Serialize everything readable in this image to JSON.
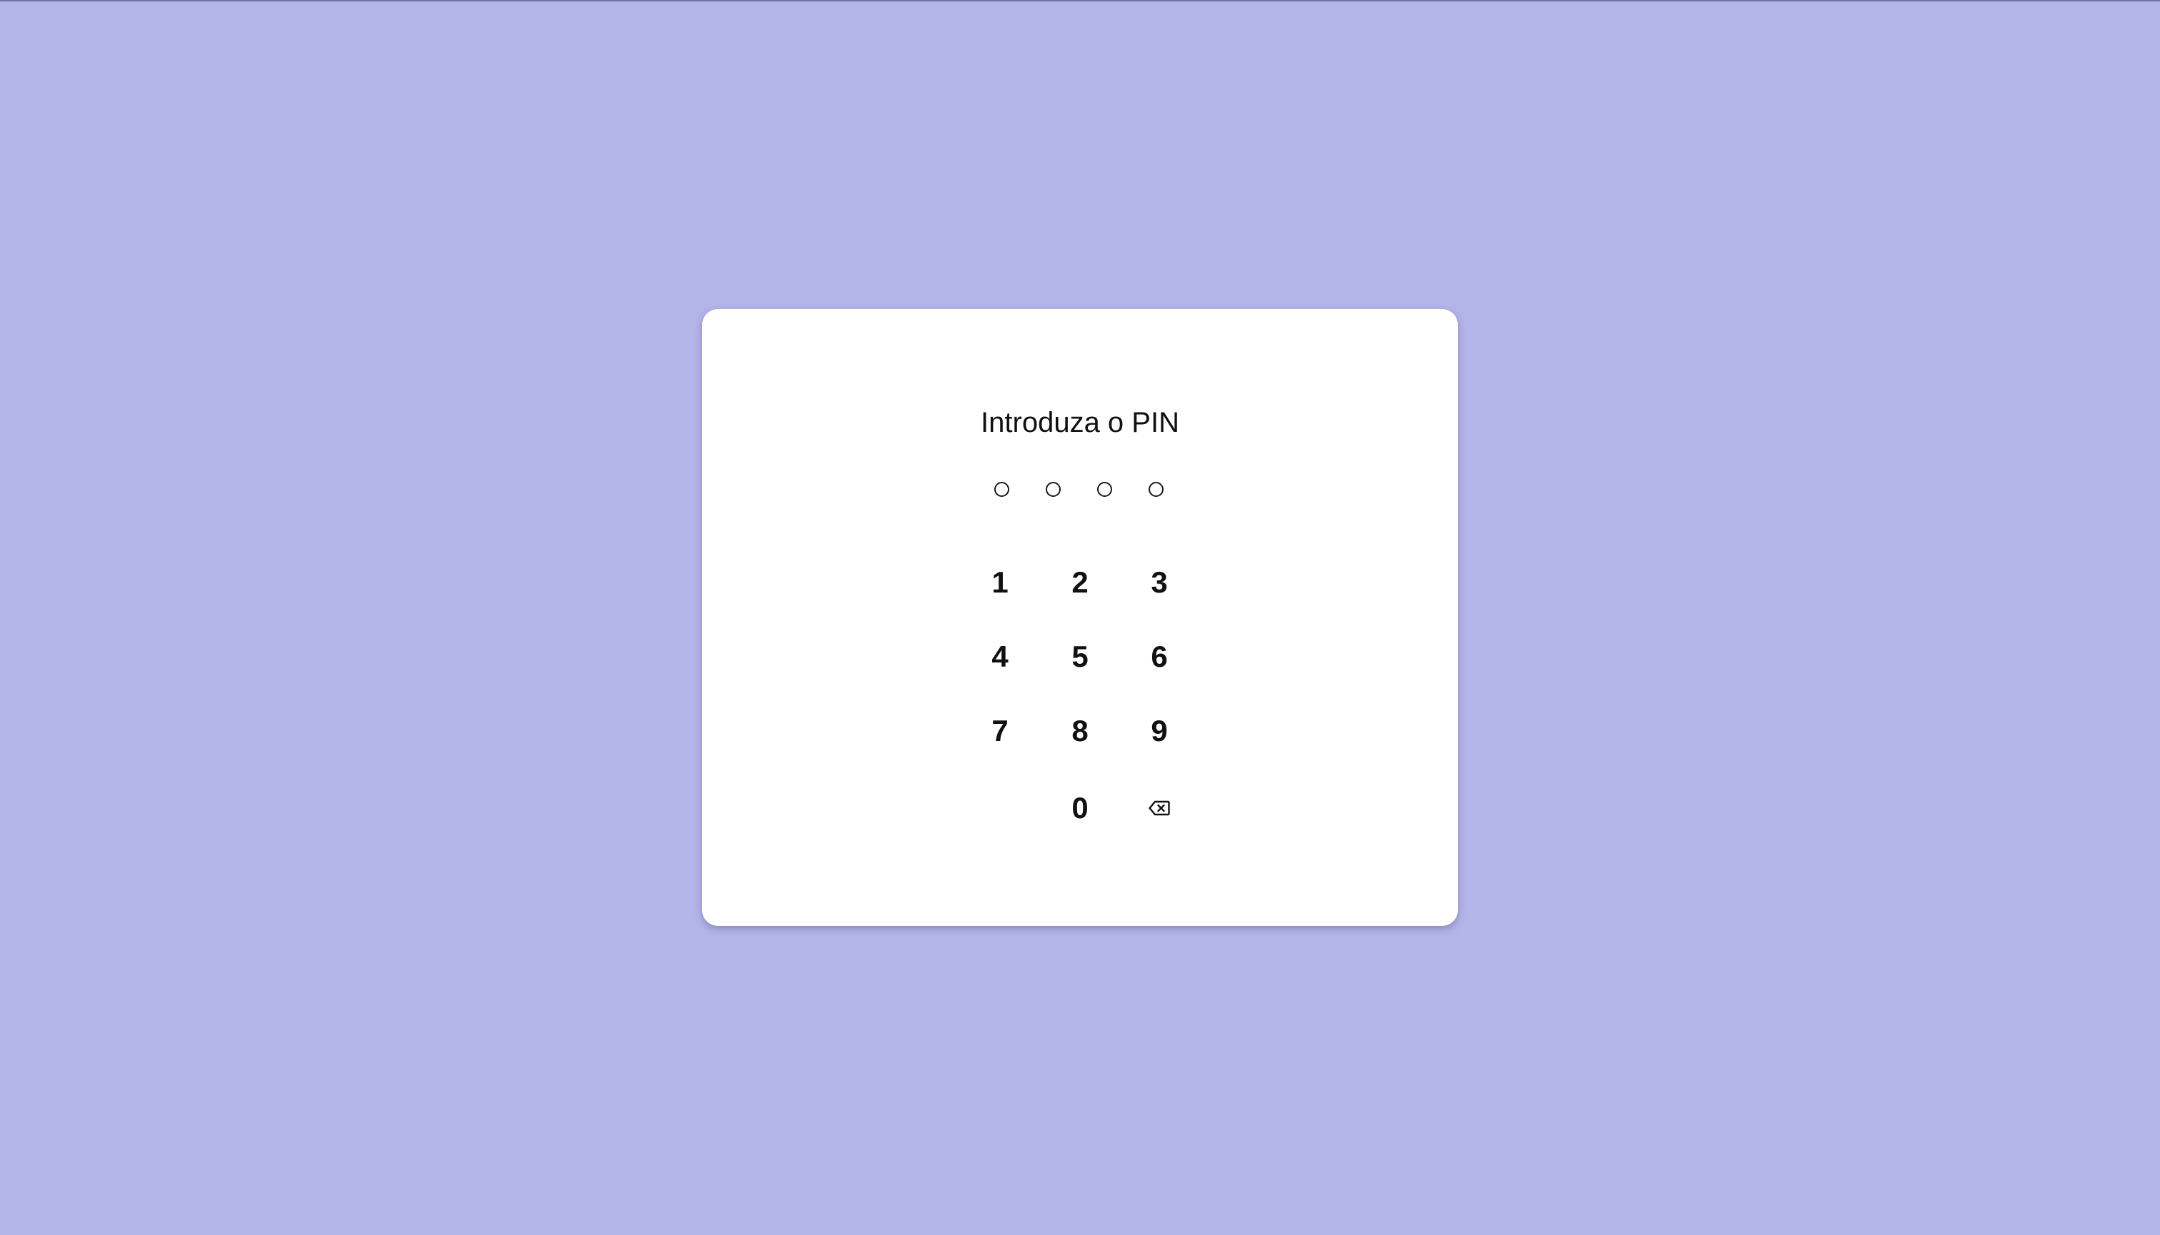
{
  "pin_screen": {
    "title": "Introduza o PIN",
    "digit_count": 4,
    "entered_count": 0
  },
  "keypad": {
    "keys": [
      "1",
      "2",
      "3",
      "4",
      "5",
      "6",
      "7",
      "8",
      "9",
      "0"
    ],
    "backspace_icon": "backspace-icon"
  },
  "colors": {
    "background": "#b3b4e8",
    "card": "#ffffff",
    "text": "#111111"
  }
}
